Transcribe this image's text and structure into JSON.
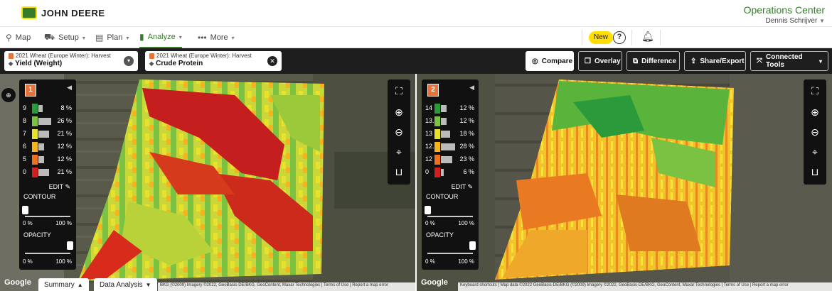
{
  "header": {
    "brand": "JOHN DEERE",
    "app_title": "Operations Center",
    "user_name": "Dennis Schrijver"
  },
  "nav": {
    "items": [
      {
        "label": "Map",
        "icon": "map-pin-icon"
      },
      {
        "label": "Setup",
        "icon": "truck-icon"
      },
      {
        "label": "Plan",
        "icon": "clipboard-icon"
      },
      {
        "label": "Analyze",
        "icon": "bar-chart-icon",
        "active": true
      },
      {
        "label": "More",
        "icon": "more-dots-icon"
      }
    ],
    "new_badge": "New"
  },
  "toolbar": {
    "layer_left": {
      "operation": "2021 Wheat (Europe Winter): Harvest",
      "name": "Yield (Weight)"
    },
    "layer_right": {
      "operation": "2021 Wheat (Europe Winter): Harvest",
      "name": "Crude Protein"
    },
    "buttons": {
      "compare": "Compare",
      "overlay": "Overlay",
      "difference": "Difference",
      "share": "Share/Export",
      "connected": "Connected Tools"
    }
  },
  "legend_left": {
    "badge": "1",
    "rows": [
      {
        "label": "9",
        "pct": "8 %",
        "value": 8,
        "color": "#2a9a3a"
      },
      {
        "label": "8",
        "pct": "26 %",
        "value": 26,
        "color": "#7cc242"
      },
      {
        "label": "7",
        "pct": "21 %",
        "value": 21,
        "color": "#e6e32a"
      },
      {
        "label": "6",
        "pct": "12 %",
        "value": 12,
        "color": "#f5b41e"
      },
      {
        "label": "5",
        "pct": "12 %",
        "value": 12,
        "color": "#ef6f1f"
      },
      {
        "label": "0",
        "pct": "21 %",
        "value": 21,
        "color": "#d11f1f"
      }
    ],
    "edit": "EDIT",
    "contour": "CONTOUR",
    "contour_min": "0 %",
    "contour_max": "100 %",
    "contour_value": 0,
    "opacity": "OPACITY",
    "opacity_min": "0 %",
    "opacity_max": "100 %",
    "opacity_value": 100
  },
  "legend_right": {
    "badge": "2",
    "rows": [
      {
        "label": "14",
        "pct": "12 %",
        "value": 12,
        "color": "#2a9a3a"
      },
      {
        "label": "13.5",
        "pct": "12 %",
        "value": 12,
        "color": "#7cc242"
      },
      {
        "label": "13",
        "pct": "18 %",
        "value": 18,
        "color": "#e6e32a"
      },
      {
        "label": "12.5",
        "pct": "28 %",
        "value": 28,
        "color": "#f5b41e"
      },
      {
        "label": "12",
        "pct": "23 %",
        "value": 23,
        "color": "#ef6f1f"
      },
      {
        "label": "0",
        "pct": "6 %",
        "value": 6,
        "color": "#d11f1f"
      }
    ],
    "edit": "EDIT",
    "contour": "CONTOUR",
    "contour_min": "0 %",
    "contour_max": "100 %",
    "contour_value": 0,
    "opacity": "OPACITY",
    "opacity_min": "0 %",
    "opacity_max": "100 %",
    "opacity_value": 100
  },
  "bottom": {
    "google": "Google",
    "summary_tab": "Summary",
    "data_tab": "Data Analysis",
    "attrib_left": "BKG (©2009) Imagery ©2022, GeoBasis-DE/BKG, GeoContent, Maxar Technologies",
    "terms": "Terms of Use",
    "report": "Report a map error",
    "shortcuts": "Keyboard shortcuts",
    "attrib_right": "Map data ©2022 GeoBasis-DE/BKG (©2009) Imagery ©2022, GeoBasis-DE/BKG, GeoContent, Maxar Technologies"
  },
  "colors": {
    "brand_green": "#367c2b",
    "brand_yellow": "#ffde00"
  }
}
